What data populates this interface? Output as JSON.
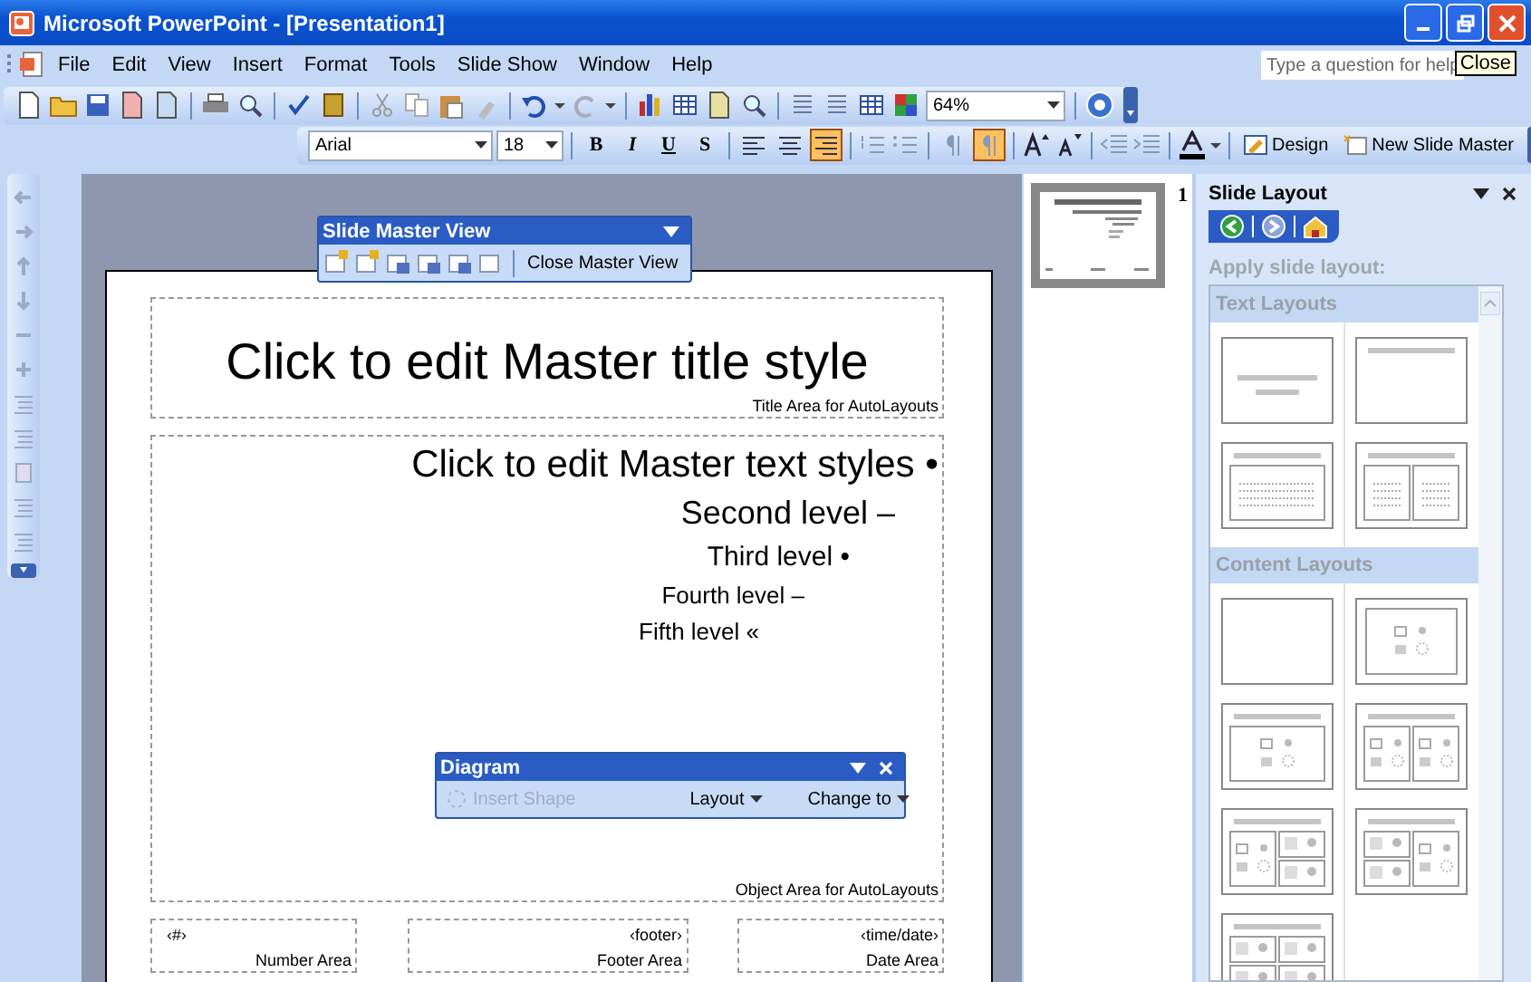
{
  "window": {
    "title": "Microsoft PowerPoint - [Presentation1]",
    "tooltip": "Close"
  },
  "menu": [
    "File",
    "Edit",
    "View",
    "Insert",
    "Format",
    "Tools",
    "Slide Show",
    "Window",
    "Help"
  ],
  "help_field": {
    "placeholder": "Type a question for help"
  },
  "standard_toolbar": {
    "zoom": "64%"
  },
  "formatting_toolbar": {
    "font": "Arial",
    "size": "18",
    "style_buttons": [
      {
        "label": "B",
        "selected": false
      },
      {
        "label": "I",
        "selected": false
      },
      {
        "label": "U",
        "selected": false
      },
      {
        "label": "S",
        "selected": false
      }
    ],
    "alignment": [
      {
        "selected": false
      },
      {
        "selected": false
      },
      {
        "selected": true
      }
    ],
    "direction": [
      {
        "selected": false
      },
      {
        "selected": true
      }
    ],
    "buttons": [
      "Design",
      "New Slide Master"
    ]
  },
  "slide_master_toolbar": {
    "title": "Slide Master View",
    "button": "Close Master View"
  },
  "diagram_toolbar": {
    "title": "Diagram",
    "buttons": [
      {
        "label": "Insert Shape",
        "disabled": true
      },
      {
        "label": "Layout",
        "disabled": false
      },
      {
        "label": "Change to",
        "disabled": false
      }
    ]
  },
  "slide": {
    "title": "Click to edit Master title style",
    "title_area": "Title Area for AutoLayouts",
    "levels": [
      "Click to edit Master text styles •",
      "Second level –",
      "Third level •",
      "Fourth level –",
      "Fifth level «"
    ],
    "object_area": "Object Area for AutoLayouts",
    "footer_boxes": [
      {
        "value": "‹#›",
        "label": "Number Area"
      },
      {
        "value": "‹footer›",
        "label": "Footer Area"
      },
      {
        "value": "‹time/date›",
        "label": "Date Area"
      }
    ]
  },
  "slides": [
    {
      "number": "1",
      "selected": true
    }
  ],
  "task_pane": {
    "title": "Slide Layout",
    "nav": [
      {
        "disabled": false
      },
      {
        "disabled": true
      },
      {
        "disabled": false
      }
    ],
    "subtitle": "Apply slide layout:",
    "sections": [
      {
        "title": "Text Layouts",
        "layouts": [
          {
            "kind": "title"
          },
          {
            "kind": "title-only"
          },
          {
            "kind": "title-text"
          },
          {
            "kind": "two-column-text"
          }
        ]
      },
      {
        "title": "Content Layouts",
        "layouts": [
          {
            "kind": "blank"
          },
          {
            "kind": "content"
          },
          {
            "kind": "title-content"
          },
          {
            "kind": "title-two-content"
          },
          {
            "kind": "content-over"
          },
          {
            "kind": "over-content"
          },
          {
            "kind": "title-four-content"
          }
        ]
      }
    ]
  }
}
